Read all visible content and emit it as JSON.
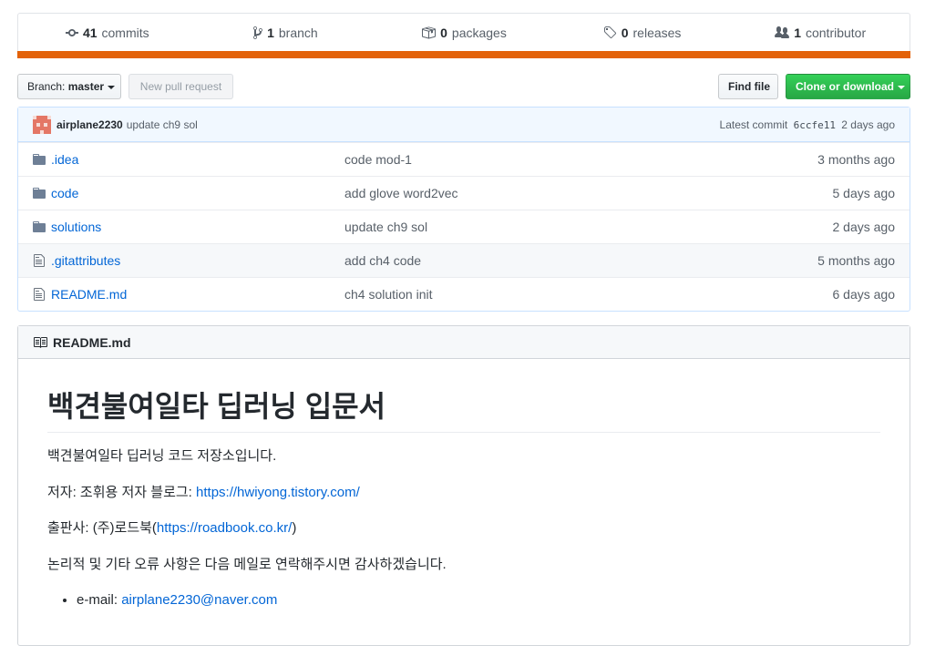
{
  "summary": {
    "commits_count": "41",
    "commits_label": "commits",
    "branch_count": "1",
    "branch_label": "branch",
    "packages_count": "0",
    "packages_label": "packages",
    "releases_count": "0",
    "releases_label": "releases",
    "contributor_count": "1",
    "contributor_label": "contributor",
    "language_color": "#e36209"
  },
  "toolbar": {
    "branch_prefix": "Branch:",
    "branch_name": "master",
    "new_pull_request": "New pull request",
    "find_file": "Find file",
    "clone_or_download": "Clone or download"
  },
  "latest_commit": {
    "author": "airplane2230",
    "message": "update ch9 sol",
    "prefix": "Latest commit",
    "sha": "6ccfe11",
    "age": "2 days ago"
  },
  "files": [
    {
      "type": "folder",
      "name": ".idea",
      "message": "code mod-1",
      "age": "3 months ago"
    },
    {
      "type": "folder",
      "name": "code",
      "message": "add glove word2vec",
      "age": "5 days ago"
    },
    {
      "type": "folder",
      "name": "solutions",
      "message": "update ch9 sol",
      "age": "2 days ago"
    },
    {
      "type": "file",
      "name": ".gitattributes",
      "message": "add ch4 code",
      "age": "5 months ago"
    },
    {
      "type": "file",
      "name": "README.md",
      "message": "ch4 solution init",
      "age": "6 days ago"
    }
  ],
  "readme": {
    "header": "README.md",
    "title": "백견불여일타 딥러닝 입문서",
    "intro": "백견불여일타 딥러닝 코드 저장소입니다.",
    "author_prefix": "저자: 조휘용 저자 블로그: ",
    "author_link": "https://hwiyong.tistory.com/",
    "publisher_prefix": "출판사: (주)로드북(",
    "publisher_link": "https://roadbook.co.kr/",
    "publisher_suffix": ")",
    "errata": "논리적 및 기타 오류 사항은 다음 메일로 연락해주시면 감사하겠습니다.",
    "email_prefix": "e-mail: ",
    "email_link": "airplane2230@naver.com"
  }
}
